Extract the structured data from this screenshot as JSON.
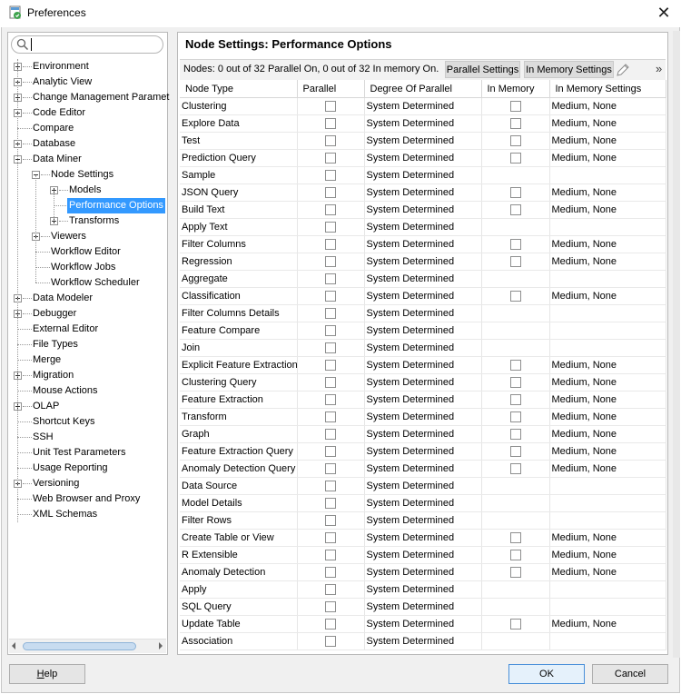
{
  "window": {
    "title": "Preferences",
    "close_glyph": "✕"
  },
  "search": {
    "value": "",
    "placeholder": ""
  },
  "tree": [
    {
      "label": "Environment",
      "level": 0,
      "expander": "plus"
    },
    {
      "label": "Analytic View",
      "level": 0,
      "expander": "plus"
    },
    {
      "label": "Change Management Paramet",
      "level": 0,
      "expander": "plus"
    },
    {
      "label": "Code Editor",
      "level": 0,
      "expander": "plus"
    },
    {
      "label": "Compare",
      "level": 0,
      "expander": "none"
    },
    {
      "label": "Database",
      "level": 0,
      "expander": "plus"
    },
    {
      "label": "Data Miner",
      "level": 0,
      "expander": "minus"
    },
    {
      "label": "Node Settings",
      "level": 1,
      "expander": "minus"
    },
    {
      "label": "Models",
      "level": 2,
      "expander": "plus"
    },
    {
      "label": "Performance Options",
      "level": 2,
      "expander": "none",
      "selected": true
    },
    {
      "label": "Transforms",
      "level": 2,
      "expander": "plus"
    },
    {
      "label": "Viewers",
      "level": 1,
      "expander": "plus"
    },
    {
      "label": "Workflow Editor",
      "level": 1,
      "expander": "none"
    },
    {
      "label": "Workflow Jobs",
      "level": 1,
      "expander": "none"
    },
    {
      "label": "Workflow Scheduler",
      "level": 1,
      "expander": "none"
    },
    {
      "label": "Data Modeler",
      "level": 0,
      "expander": "plus"
    },
    {
      "label": "Debugger",
      "level": 0,
      "expander": "plus"
    },
    {
      "label": "External Editor",
      "level": 0,
      "expander": "none"
    },
    {
      "label": "File Types",
      "level": 0,
      "expander": "none"
    },
    {
      "label": "Merge",
      "level": 0,
      "expander": "none"
    },
    {
      "label": "Migration",
      "level": 0,
      "expander": "plus"
    },
    {
      "label": "Mouse Actions",
      "level": 0,
      "expander": "none"
    },
    {
      "label": "OLAP",
      "level": 0,
      "expander": "plus"
    },
    {
      "label": "Shortcut Keys",
      "level": 0,
      "expander": "none"
    },
    {
      "label": "SSH",
      "level": 0,
      "expander": "none"
    },
    {
      "label": "Unit Test Parameters",
      "level": 0,
      "expander": "none"
    },
    {
      "label": "Usage Reporting",
      "level": 0,
      "expander": "none"
    },
    {
      "label": "Versioning",
      "level": 0,
      "expander": "plus"
    },
    {
      "label": "Web Browser and Proxy",
      "level": 0,
      "expander": "none"
    },
    {
      "label": "XML Schemas",
      "level": 0,
      "expander": "none"
    }
  ],
  "panel": {
    "title": "Node Settings: Performance Options",
    "info": "Nodes: 0 out of 32 Parallel On, 0 out of 32 In memory On.",
    "parallel_settings": "Parallel Settings",
    "in_memory_settings": "In Memory Settings",
    "more": "»"
  },
  "table": {
    "columns": [
      "Node Type",
      "Parallel",
      "Degree Of Parallel",
      "In Memory",
      "In Memory Settings"
    ],
    "rows": [
      {
        "node": "Clustering",
        "degree": "System Determined",
        "mem": true,
        "mem_settings": "Medium, None"
      },
      {
        "node": "Explore Data",
        "degree": "System Determined",
        "mem": true,
        "mem_settings": "Medium, None"
      },
      {
        "node": "Test",
        "degree": "System Determined",
        "mem": true,
        "mem_settings": "Medium, None"
      },
      {
        "node": "Prediction Query",
        "degree": "System Determined",
        "mem": true,
        "mem_settings": "Medium, None"
      },
      {
        "node": "Sample",
        "degree": "System Determined",
        "mem": false,
        "mem_settings": ""
      },
      {
        "node": "JSON Query",
        "degree": "System Determined",
        "mem": true,
        "mem_settings": "Medium, None"
      },
      {
        "node": "Build Text",
        "degree": "System Determined",
        "mem": true,
        "mem_settings": "Medium, None"
      },
      {
        "node": "Apply Text",
        "degree": "System Determined",
        "mem": false,
        "mem_settings": ""
      },
      {
        "node": "Filter Columns",
        "degree": "System Determined",
        "mem": true,
        "mem_settings": "Medium, None"
      },
      {
        "node": "Regression",
        "degree": "System Determined",
        "mem": true,
        "mem_settings": "Medium, None"
      },
      {
        "node": "Aggregate",
        "degree": "System Determined",
        "mem": false,
        "mem_settings": ""
      },
      {
        "node": "Classification",
        "degree": "System Determined",
        "mem": true,
        "mem_settings": "Medium, None"
      },
      {
        "node": "Filter Columns Details",
        "degree": "System Determined",
        "mem": false,
        "mem_settings": ""
      },
      {
        "node": "Feature Compare",
        "degree": "System Determined",
        "mem": false,
        "mem_settings": ""
      },
      {
        "node": "Join",
        "degree": "System Determined",
        "mem": false,
        "mem_settings": ""
      },
      {
        "node": "Explicit Feature Extraction",
        "degree": "System Determined",
        "mem": true,
        "mem_settings": "Medium, None"
      },
      {
        "node": "Clustering Query",
        "degree": "System Determined",
        "mem": true,
        "mem_settings": "Medium, None"
      },
      {
        "node": "Feature Extraction",
        "degree": "System Determined",
        "mem": true,
        "mem_settings": "Medium, None"
      },
      {
        "node": "Transform",
        "degree": "System Determined",
        "mem": true,
        "mem_settings": "Medium, None"
      },
      {
        "node": "Graph",
        "degree": "System Determined",
        "mem": true,
        "mem_settings": "Medium, None"
      },
      {
        "node": "Feature Extraction Query",
        "degree": "System Determined",
        "mem": true,
        "mem_settings": "Medium, None"
      },
      {
        "node": "Anomaly Detection Query",
        "degree": "System Determined",
        "mem": true,
        "mem_settings": "Medium, None"
      },
      {
        "node": "Data Source",
        "degree": "System Determined",
        "mem": false,
        "mem_settings": ""
      },
      {
        "node": "Model Details",
        "degree": "System Determined",
        "mem": false,
        "mem_settings": ""
      },
      {
        "node": "Filter Rows",
        "degree": "System Determined",
        "mem": false,
        "mem_settings": ""
      },
      {
        "node": "Create Table or View",
        "degree": "System Determined",
        "mem": true,
        "mem_settings": "Medium, None"
      },
      {
        "node": "R Extensible",
        "degree": "System Determined",
        "mem": true,
        "mem_settings": "Medium, None"
      },
      {
        "node": "Anomaly Detection",
        "degree": "System Determined",
        "mem": true,
        "mem_settings": "Medium, None"
      },
      {
        "node": "Apply",
        "degree": "System Determined",
        "mem": false,
        "mem_settings": ""
      },
      {
        "node": "SQL Query",
        "degree": "System Determined",
        "mem": false,
        "mem_settings": ""
      },
      {
        "node": "Update Table",
        "degree": "System Determined",
        "mem": true,
        "mem_settings": "Medium, None"
      },
      {
        "node": "Association",
        "degree": "System Determined",
        "mem": false,
        "mem_settings": ""
      }
    ]
  },
  "buttons": {
    "help_mnemonic": "H",
    "help_rest": "elp",
    "ok": "OK",
    "cancel": "Cancel"
  }
}
